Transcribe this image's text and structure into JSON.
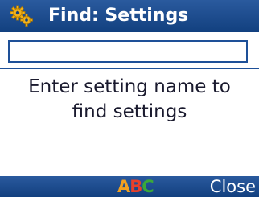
{
  "titlebar": {
    "icon": "gears-icon",
    "title": "Find: Settings"
  },
  "search": {
    "value": "",
    "placeholder": ""
  },
  "hint": {
    "text": "Enter setting name to\nfind settings"
  },
  "softkeys": {
    "input_mode": {
      "letters": [
        "A",
        "B",
        "C"
      ],
      "colors": [
        "#f0a020",
        "#e8402a",
        "#3aa83a"
      ]
    },
    "right_label": "Close"
  },
  "colors": {
    "bar_blue": "#1a4a8c",
    "accent_gold": "#f2b21c"
  }
}
